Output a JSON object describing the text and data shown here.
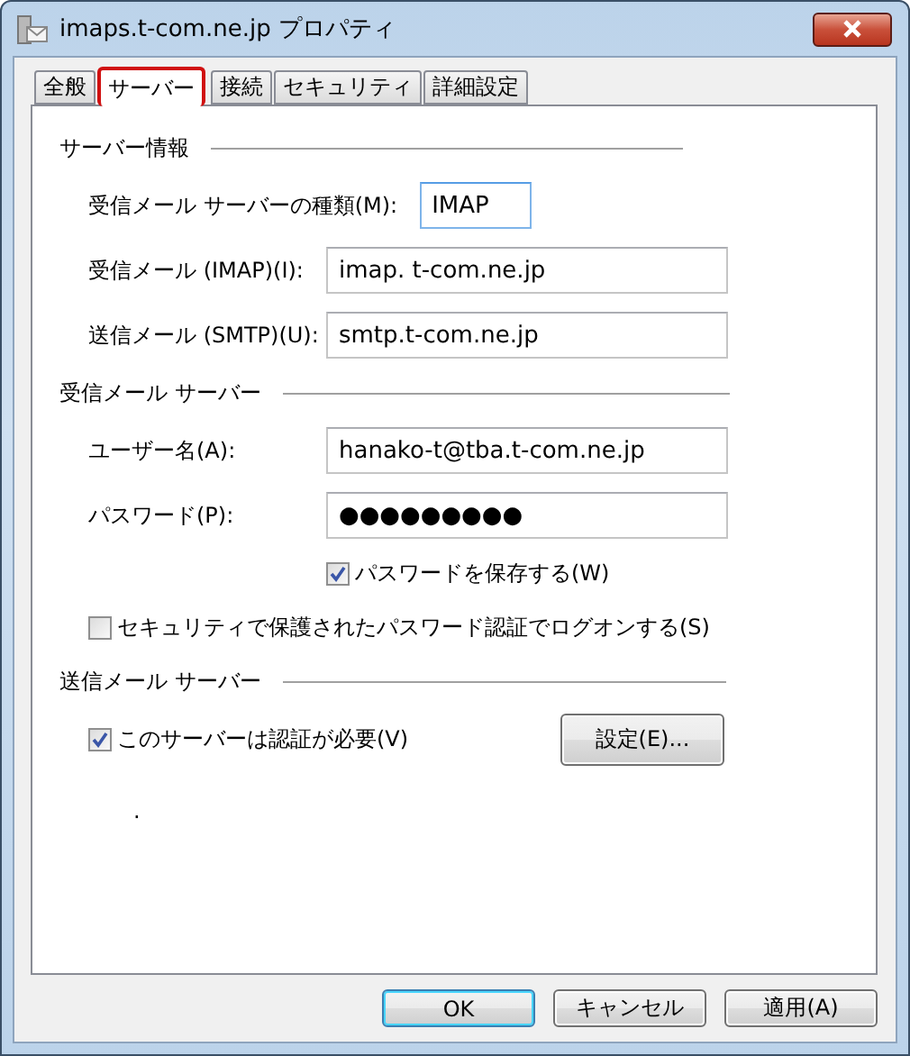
{
  "window": {
    "title": "imaps.t-com.ne.jp プロパティ"
  },
  "tabs": [
    {
      "label": "全般",
      "selected": false,
      "highlighted": false
    },
    {
      "label": "サーバー",
      "selected": true,
      "highlighted": true
    },
    {
      "label": "接続",
      "selected": false,
      "highlighted": false
    },
    {
      "label": "セキュリティ",
      "selected": false,
      "highlighted": false
    },
    {
      "label": "詳細設定",
      "selected": false,
      "highlighted": false
    }
  ],
  "sections": [
    {
      "title": "サーバー情報",
      "items": [
        {
          "kind": "field",
          "label": "受信メール サーバーの種類(M):",
          "value": "IMAP",
          "narrow": true
        },
        {
          "kind": "field",
          "label": "受信メール (IMAP)(I):",
          "value": "imap. t-com.ne.jp"
        },
        {
          "kind": "field",
          "label": "送信メール (SMTP)(U):",
          "value": "smtp.t-com.ne.jp"
        }
      ]
    },
    {
      "title": "受信メール サーバー",
      "items": [
        {
          "kind": "field",
          "label": "ユーザー名(A):",
          "value": "hanako-t@tba.t-com.ne.jp"
        },
        {
          "kind": "field",
          "label": "パスワード(P):",
          "value": "●●●●●●●●●"
        },
        {
          "kind": "aligned_checkbox",
          "label": "パスワードを保存する(W)",
          "checked": true
        },
        {
          "kind": "checkbox",
          "label": "セキュリティで保護されたパスワード認証でログオンする(S)",
          "checked": false
        }
      ]
    },
    {
      "title": "送信メール サーバー",
      "items": [
        {
          "kind": "checkbox",
          "label": "このサーバーは認証が必要(V)",
          "checked": true,
          "button": "設定(E)..."
        }
      ]
    }
  ],
  "stray_mark": ".",
  "buttons": [
    {
      "label": "OK",
      "default": true
    },
    {
      "label": "キャンセル",
      "default": false
    },
    {
      "label": "適用(A)",
      "default": false
    }
  ]
}
